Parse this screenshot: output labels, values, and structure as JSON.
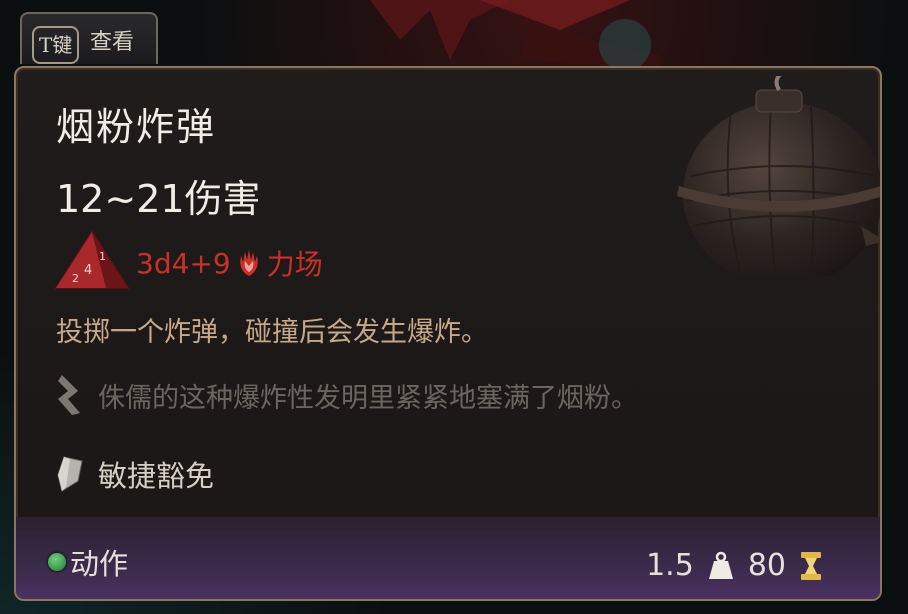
{
  "hint_tab": {
    "key": "T键",
    "label": "查看"
  },
  "item": {
    "name": "烟粉炸弹",
    "damage": "12~21伤害",
    "dice_formula": "3d4+9",
    "damage_type": "力场",
    "description": "投掷一个炸弹，碰撞后会发生爆炸。",
    "flavor": "侏儒的这种爆炸性发明里紧紧地塞满了烟粉。",
    "saving_throw": "敏捷豁免"
  },
  "footer": {
    "action_type": "动作",
    "weight": "1.5",
    "price": "80"
  },
  "colors": {
    "damage_red": "#c9302a",
    "description": "#c8a78a",
    "flavor": "#6b6560",
    "border": "#8a7760"
  },
  "icons": {
    "dice": "d4-dice-icon",
    "damage_type": "force-hand-icon",
    "flavor": "quill-icon",
    "save": "shield-icon",
    "action": "action-dot-icon",
    "weight": "weight-icon",
    "price": "gold-icon"
  }
}
